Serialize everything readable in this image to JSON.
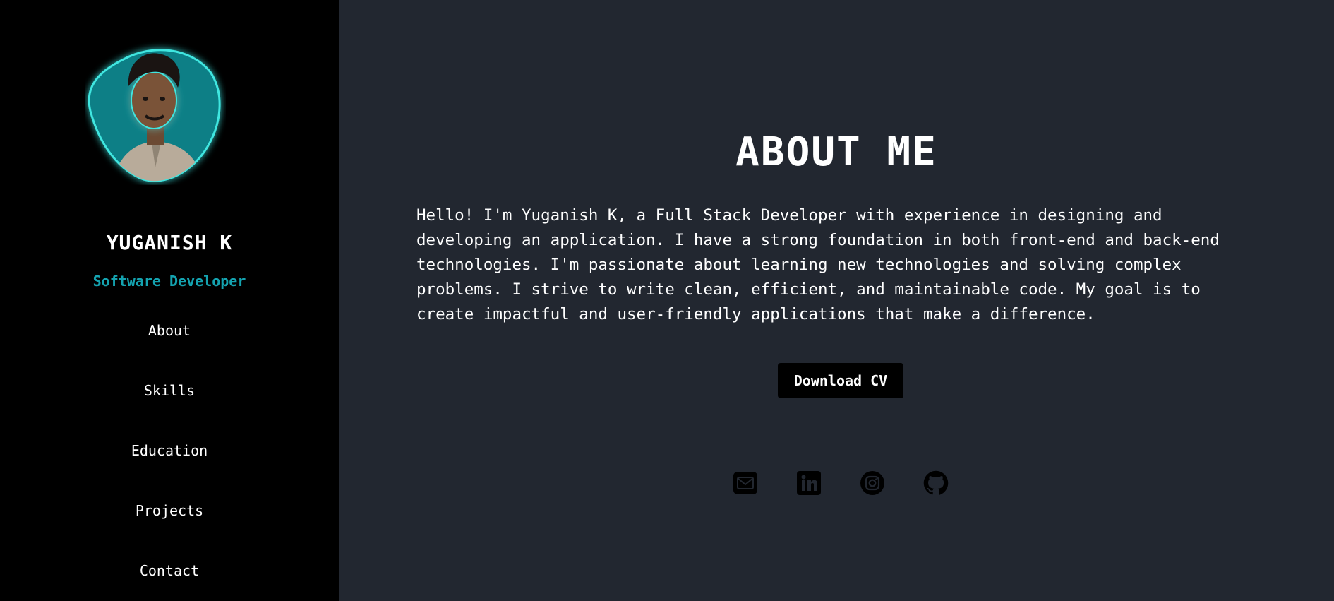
{
  "profile": {
    "name": "YUGANISH K",
    "role": "Software Developer",
    "accent_color": "#14a3b0"
  },
  "nav": {
    "about": "About",
    "skills": "Skills",
    "education": "Education",
    "projects": "Projects",
    "contact": "Contact"
  },
  "about": {
    "title": "ABOUT ME",
    "text": "Hello! I'm Yuganish K, a Full Stack Developer with experience in designing and developing an application. I have a strong foundation in both front-end and back-end technologies. I'm passionate about learning new technologies and solving complex problems. I strive to write clean, efficient, and maintainable code. My goal is to create impactful and user-friendly applications that make a difference.",
    "cv_button": "Download CV"
  },
  "socials": {
    "icons": [
      "mail-icon",
      "linkedin-icon",
      "instagram-icon",
      "github-icon"
    ]
  }
}
